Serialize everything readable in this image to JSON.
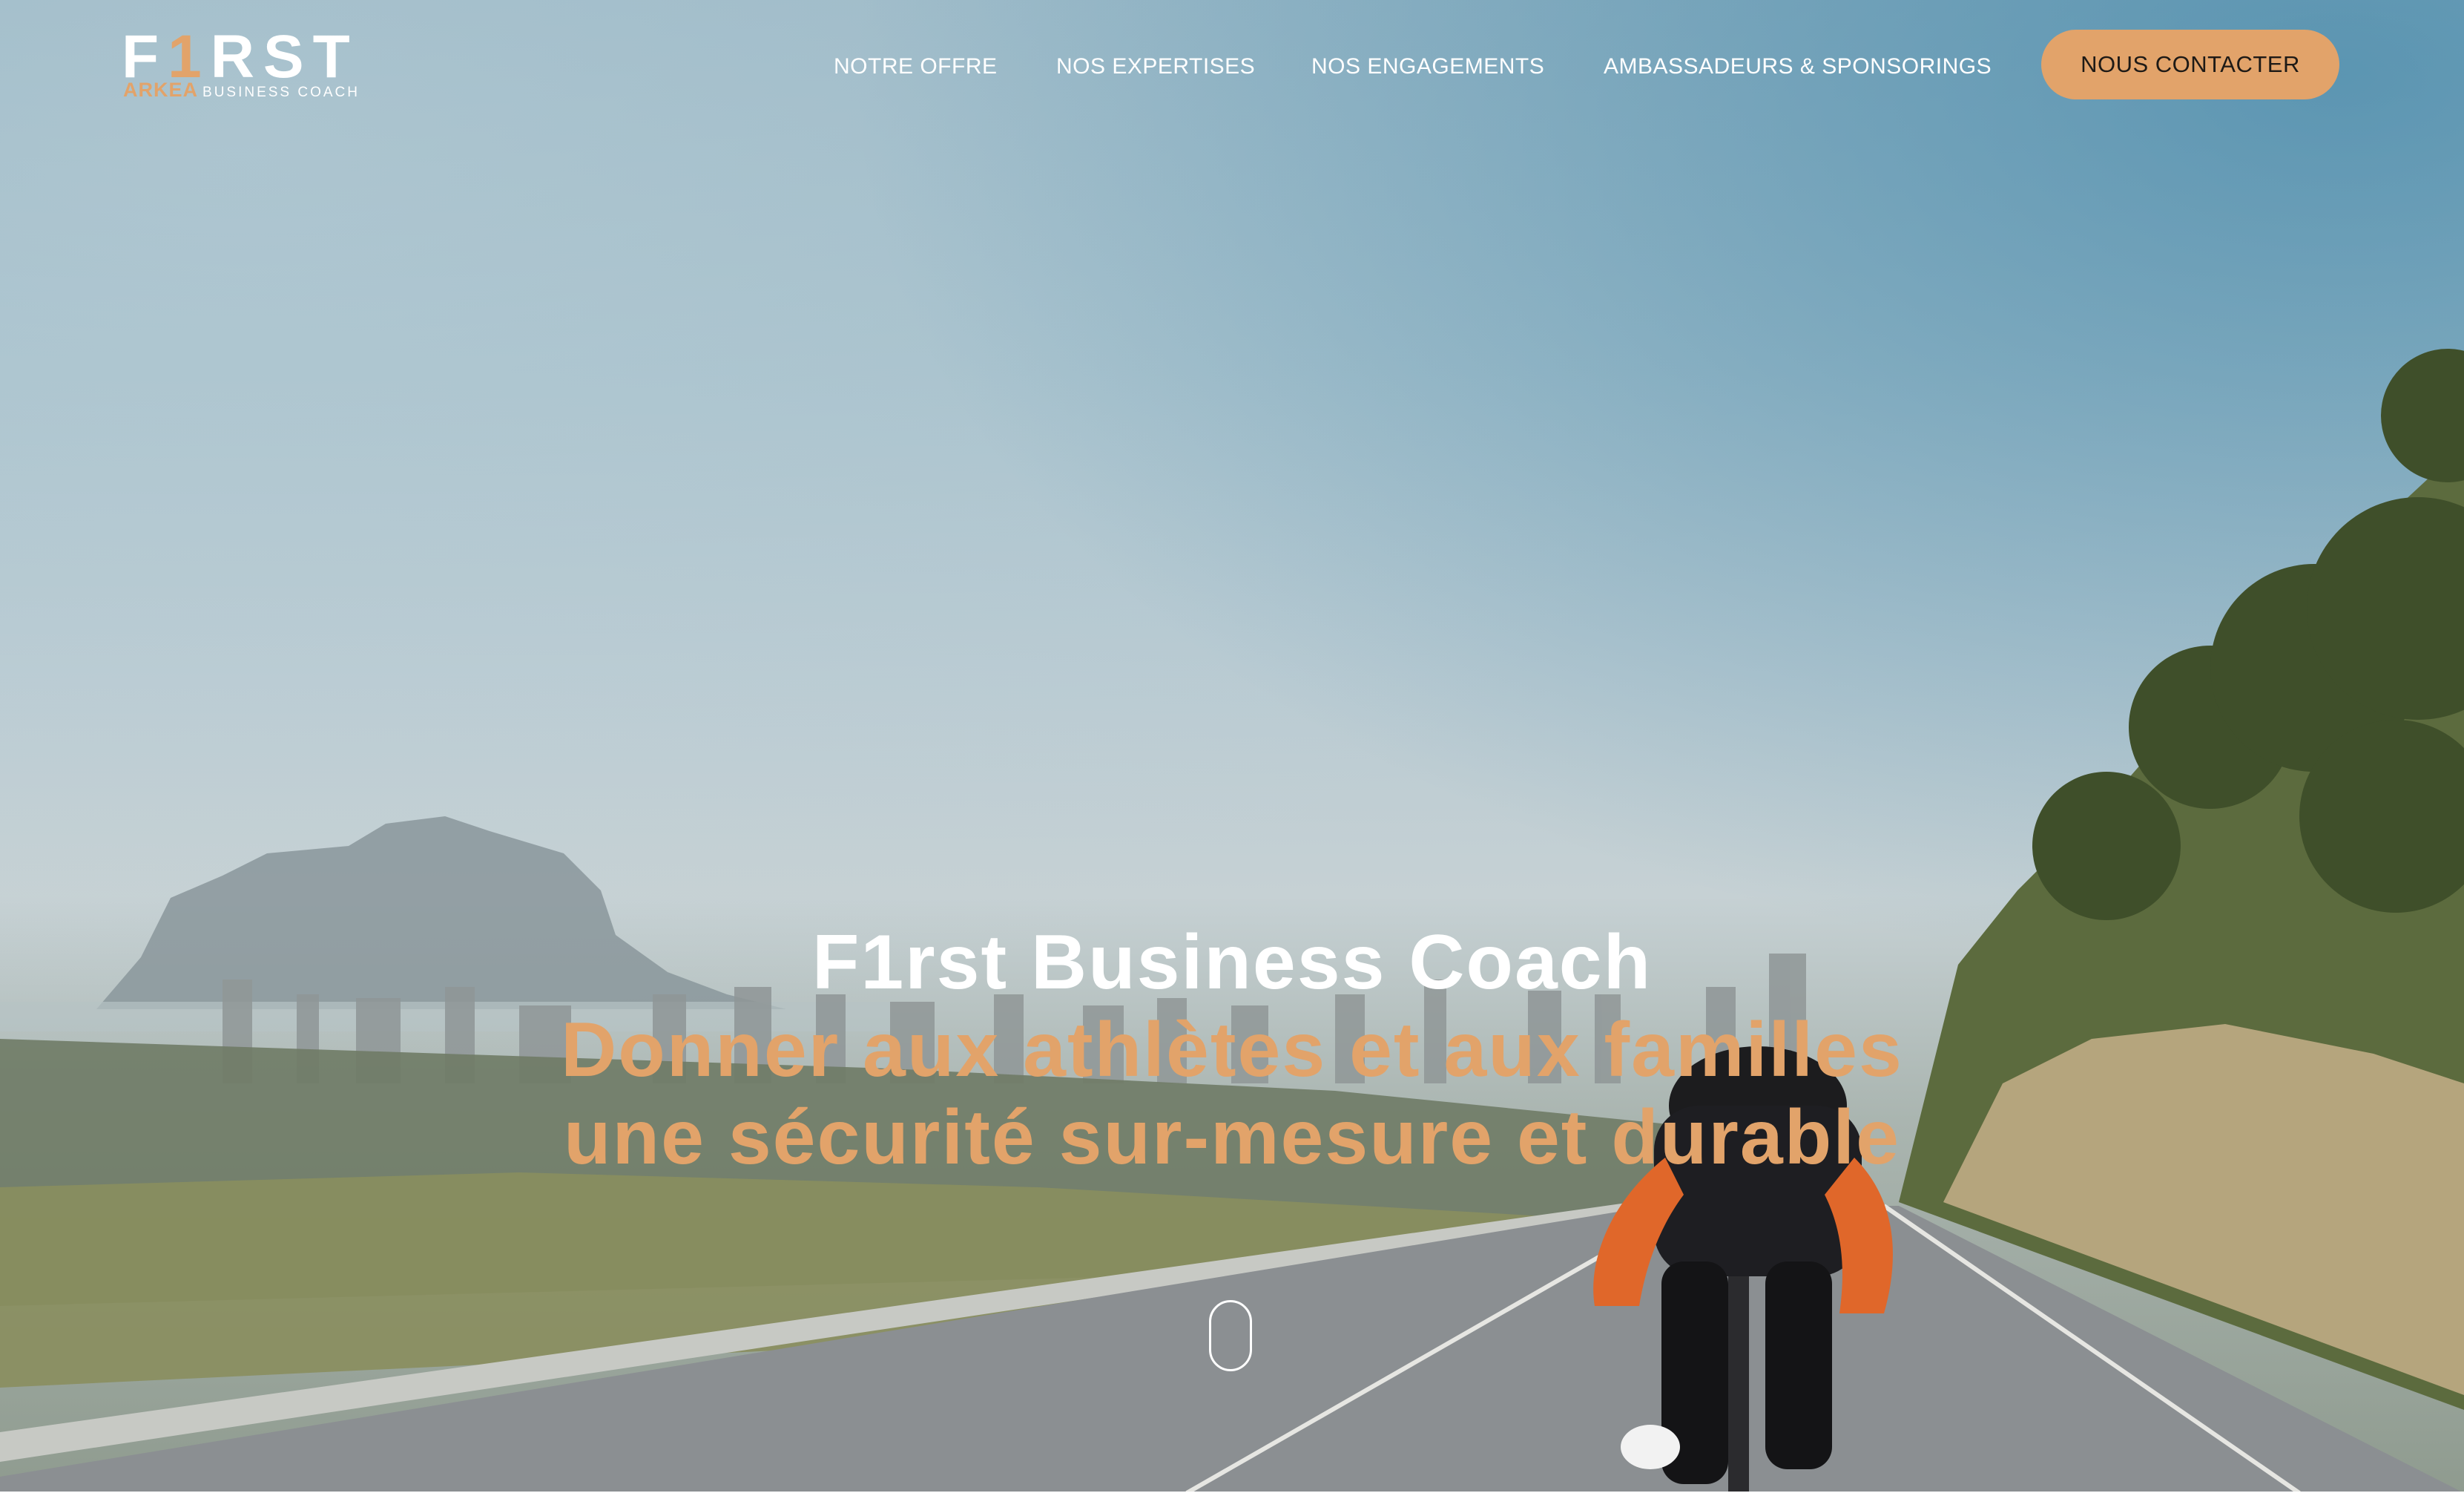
{
  "brand": {
    "logo_main_left": "F",
    "logo_main_digit": "1",
    "logo_main_right": "RST",
    "logo_arkea": "ARKEA",
    "logo_coach": "BUSINESS COACH",
    "accent_color": "#e2a36a"
  },
  "nav": {
    "items": [
      {
        "label": "NOTRE OFFRE"
      },
      {
        "label": "NOS EXPERTISES"
      },
      {
        "label": "NOS ENGAGEMENTS"
      },
      {
        "label": "AMBASSADEURS & SPONSORINGS"
      }
    ],
    "cta_label": "NOUS CONTACTER"
  },
  "hero": {
    "title": "F1rst Business Coach",
    "tagline_line1": "Donner aux athlètes et aux familles",
    "tagline_line2": "une sécurité sur-mesure et durable",
    "background": "cyclist-on-coastal-road-photo",
    "scroll_icon": "mouse-scroll-icon"
  }
}
